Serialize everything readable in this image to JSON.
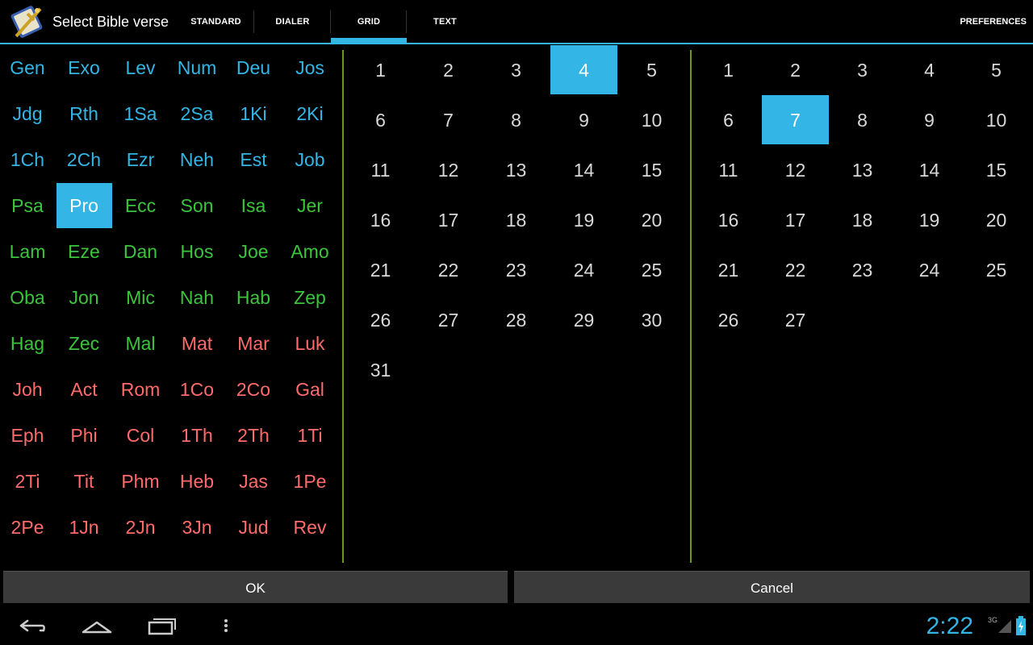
{
  "actionbar": {
    "title": "Select Bible verse",
    "tabs": [
      {
        "label": "STANDARD",
        "active": false
      },
      {
        "label": "DIALER",
        "active": false
      },
      {
        "label": "GRID",
        "active": true
      },
      {
        "label": "TEXT",
        "active": false
      }
    ],
    "preferences_label": "PREFERENCES"
  },
  "books": {
    "selected": "Pro",
    "colors": {
      "ot_history": "#33b5e5",
      "ot_poetry_prophets": "#3cc43c",
      "nt": "#ff6b6b"
    },
    "rows": [
      [
        {
          "name": "Gen",
          "group": "ot_history"
        },
        {
          "name": "Exo",
          "group": "ot_history"
        },
        {
          "name": "Lev",
          "group": "ot_history"
        },
        {
          "name": "Num",
          "group": "ot_history"
        },
        {
          "name": "Deu",
          "group": "ot_history"
        },
        {
          "name": "Jos",
          "group": "ot_history"
        }
      ],
      [
        {
          "name": "Jdg",
          "group": "ot_history"
        },
        {
          "name": "Rth",
          "group": "ot_history"
        },
        {
          "name": "1Sa",
          "group": "ot_history"
        },
        {
          "name": "2Sa",
          "group": "ot_history"
        },
        {
          "name": "1Ki",
          "group": "ot_history"
        },
        {
          "name": "2Ki",
          "group": "ot_history"
        }
      ],
      [
        {
          "name": "1Ch",
          "group": "ot_history"
        },
        {
          "name": "2Ch",
          "group": "ot_history"
        },
        {
          "name": "Ezr",
          "group": "ot_history"
        },
        {
          "name": "Neh",
          "group": "ot_history"
        },
        {
          "name": "Est",
          "group": "ot_history"
        },
        {
          "name": "Job",
          "group": "ot_history"
        }
      ],
      [
        {
          "name": "Psa",
          "group": "ot_poetry_prophets"
        },
        {
          "name": "Pro",
          "group": "ot_poetry_prophets"
        },
        {
          "name": "Ecc",
          "group": "ot_poetry_prophets"
        },
        {
          "name": "Son",
          "group": "ot_poetry_prophets"
        },
        {
          "name": "Isa",
          "group": "ot_poetry_prophets"
        },
        {
          "name": "Jer",
          "group": "ot_poetry_prophets"
        }
      ],
      [
        {
          "name": "Lam",
          "group": "ot_poetry_prophets"
        },
        {
          "name": "Eze",
          "group": "ot_poetry_prophets"
        },
        {
          "name": "Dan",
          "group": "ot_poetry_prophets"
        },
        {
          "name": "Hos",
          "group": "ot_poetry_prophets"
        },
        {
          "name": "Joe",
          "group": "ot_poetry_prophets"
        },
        {
          "name": "Amo",
          "group": "ot_poetry_prophets"
        }
      ],
      [
        {
          "name": "Oba",
          "group": "ot_poetry_prophets"
        },
        {
          "name": "Jon",
          "group": "ot_poetry_prophets"
        },
        {
          "name": "Mic",
          "group": "ot_poetry_prophets"
        },
        {
          "name": "Nah",
          "group": "ot_poetry_prophets"
        },
        {
          "name": "Hab",
          "group": "ot_poetry_prophets"
        },
        {
          "name": "Zep",
          "group": "ot_poetry_prophets"
        }
      ],
      [
        {
          "name": "Hag",
          "group": "ot_poetry_prophets"
        },
        {
          "name": "Zec",
          "group": "ot_poetry_prophets"
        },
        {
          "name": "Mal",
          "group": "ot_poetry_prophets"
        },
        {
          "name": "Mat",
          "group": "nt"
        },
        {
          "name": "Mar",
          "group": "nt"
        },
        {
          "name": "Luk",
          "group": "nt"
        }
      ],
      [
        {
          "name": "Joh",
          "group": "nt"
        },
        {
          "name": "Act",
          "group": "nt"
        },
        {
          "name": "Rom",
          "group": "nt"
        },
        {
          "name": "1Co",
          "group": "nt"
        },
        {
          "name": "2Co",
          "group": "nt"
        },
        {
          "name": "Gal",
          "group": "nt"
        }
      ],
      [
        {
          "name": "Eph",
          "group": "nt"
        },
        {
          "name": "Phi",
          "group": "nt"
        },
        {
          "name": "Col",
          "group": "nt"
        },
        {
          "name": "1Th",
          "group": "nt"
        },
        {
          "name": "2Th",
          "group": "nt"
        },
        {
          "name": "1Ti",
          "group": "nt"
        }
      ],
      [
        {
          "name": "2Ti",
          "group": "nt"
        },
        {
          "name": "Tit",
          "group": "nt"
        },
        {
          "name": "Phm",
          "group": "nt"
        },
        {
          "name": "Heb",
          "group": "nt"
        },
        {
          "name": "Jas",
          "group": "nt"
        },
        {
          "name": "1Pe",
          "group": "nt"
        }
      ],
      [
        {
          "name": "2Pe",
          "group": "nt"
        },
        {
          "name": "1Jn",
          "group": "nt"
        },
        {
          "name": "2Jn",
          "group": "nt"
        },
        {
          "name": "3Jn",
          "group": "nt"
        },
        {
          "name": "Jud",
          "group": "nt"
        },
        {
          "name": "Rev",
          "group": "nt"
        }
      ]
    ]
  },
  "chapters": {
    "numbers": [
      "1",
      "2",
      "3",
      "4",
      "5",
      "6",
      "7",
      "8",
      "9",
      "10",
      "11",
      "12",
      "13",
      "14",
      "15",
      "16",
      "17",
      "18",
      "19",
      "20",
      "21",
      "22",
      "23",
      "24",
      "25",
      "26",
      "27",
      "28",
      "29",
      "30",
      "31"
    ],
    "selected": "4"
  },
  "verses": {
    "numbers": [
      "1",
      "2",
      "3",
      "4",
      "5",
      "6",
      "7",
      "8",
      "9",
      "10",
      "11",
      "12",
      "13",
      "14",
      "15",
      "16",
      "17",
      "18",
      "19",
      "20",
      "21",
      "22",
      "23",
      "24",
      "25",
      "26",
      "27"
    ],
    "selected": "7"
  },
  "buttons": {
    "ok": "OK",
    "cancel": "Cancel"
  },
  "status": {
    "time": "2:22",
    "network": "3G"
  },
  "accent_color": "#33b5e5"
}
